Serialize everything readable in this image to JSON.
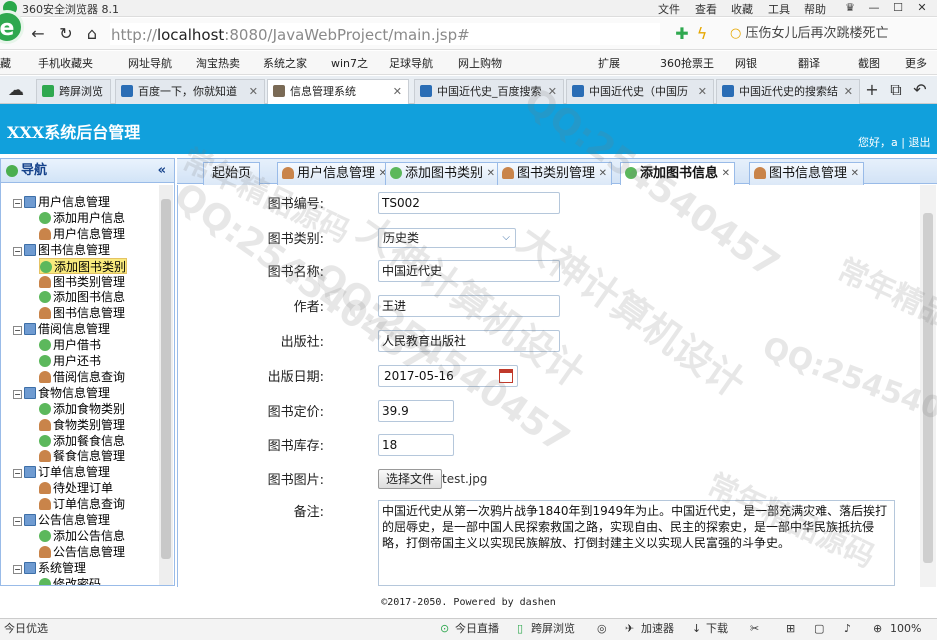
{
  "browser": {
    "window_title": "360安全浏览器 8.1",
    "menus": [
      "文件",
      "查看",
      "收藏",
      "工具",
      "帮助"
    ],
    "url_prefix": "http://",
    "url_host": "localhost",
    "url_rest": ":8080/JavaWebProject/main.jsp#",
    "search_text": "压伤女儿后再次跳楼死亡",
    "favorites": [
      "藏",
      "手机收藏夹",
      "网址导航",
      "淘宝热卖",
      "系统之家",
      "win7之",
      "足球导航",
      "网上购物",
      "扩展",
      "360抢票王",
      "网银",
      "翻译",
      "截图",
      "更多"
    ],
    "tabs": [
      {
        "label": "跨屏浏览",
        "active": false
      },
      {
        "label": "百度一下，你就知道",
        "active": false
      },
      {
        "label": "信息管理系统",
        "active": true
      },
      {
        "label": "中国近代史_百度搜索",
        "active": false
      },
      {
        "label": "中国近代史（中国历",
        "active": false
      },
      {
        "label": "中国近代史的搜索结",
        "active": false
      }
    ]
  },
  "app": {
    "title": "XXX系统后台管理",
    "user_text": "您好，a",
    "logout": "退出"
  },
  "sidebar": {
    "title": "导航",
    "collapse": "«",
    "nodes": [
      {
        "label": "用户信息管理",
        "level": 0,
        "icon": "folder-icon"
      },
      {
        "label": "添加用户信息",
        "level": 1,
        "icon": "add-icon"
      },
      {
        "label": "用户信息管理",
        "level": 1,
        "icon": "user-icon"
      },
      {
        "label": "图书信息管理",
        "level": 0,
        "icon": "folder-icon"
      },
      {
        "label": "添加图书类别",
        "level": 1,
        "icon": "add-icon",
        "selected": true
      },
      {
        "label": "图书类别管理",
        "level": 1,
        "icon": "user-icon"
      },
      {
        "label": "添加图书信息",
        "level": 1,
        "icon": "add-icon"
      },
      {
        "label": "图书信息管理",
        "level": 1,
        "icon": "user-icon"
      },
      {
        "label": "借阅信息管理",
        "level": 0,
        "icon": "folder-icon"
      },
      {
        "label": "用户借书",
        "level": 1,
        "icon": "add-icon"
      },
      {
        "label": "用户还书",
        "level": 1,
        "icon": "add-icon"
      },
      {
        "label": "借阅信息查询",
        "level": 1,
        "icon": "user-icon"
      },
      {
        "label": "食物信息管理",
        "level": 0,
        "icon": "folder-icon"
      },
      {
        "label": "添加食物类别",
        "level": 1,
        "icon": "add-icon"
      },
      {
        "label": "食物类别管理",
        "level": 1,
        "icon": "user-icon"
      },
      {
        "label": "添加餐食信息",
        "level": 1,
        "icon": "add-icon"
      },
      {
        "label": "餐食信息管理",
        "level": 1,
        "icon": "user-icon"
      },
      {
        "label": "订单信息管理",
        "level": 0,
        "icon": "folder-icon"
      },
      {
        "label": "待处理订单",
        "level": 1,
        "icon": "user-icon"
      },
      {
        "label": "订单信息查询",
        "level": 1,
        "icon": "user-icon"
      },
      {
        "label": "公告信息管理",
        "level": 0,
        "icon": "folder-icon"
      },
      {
        "label": "添加公告信息",
        "level": 1,
        "icon": "add-icon"
      },
      {
        "label": "公告信息管理",
        "level": 1,
        "icon": "user-icon"
      },
      {
        "label": "系统管理",
        "level": 0,
        "icon": "folder-icon"
      },
      {
        "label": "修改密码",
        "level": 1,
        "icon": "pencil-icon"
      }
    ]
  },
  "main_tabs": [
    {
      "label": "起始页",
      "icon": "",
      "closable": false
    },
    {
      "label": "用户信息管理",
      "icon": "user-icon",
      "closable": true
    },
    {
      "label": "添加图书类别",
      "icon": "add-icon",
      "closable": true
    },
    {
      "label": "图书类别管理",
      "icon": "user-icon",
      "closable": true
    },
    {
      "label": "添加图书信息",
      "icon": "add-icon",
      "closable": true,
      "active": true
    },
    {
      "label": "图书信息管理",
      "icon": "user-icon",
      "closable": true
    }
  ],
  "form": {
    "book_no_label": "图书编号:",
    "book_no": "TS002",
    "category_label": "图书类别:",
    "category": "历史类",
    "name_label": "图书名称:",
    "name": "中国近代史",
    "author_label": "作者:",
    "author": "王进",
    "publisher_label": "出版社:",
    "publisher": "人民教育出版社",
    "pub_date_label": "出版日期:",
    "pub_date": "2017-05-16",
    "price_label": "图书定价:",
    "price": "39.9",
    "stock_label": "图书库存:",
    "stock": "18",
    "photo_label": "图书图片:",
    "file_button": "选择文件",
    "file_name": "test.jpg",
    "remark_label": "备注:",
    "remark": "中国近代史从第一次鸦片战争1840年到1949年为止。中国近代史，是一部充满灾难、落后挨打的屈辱史，是一部中国人民探索救国之路，实现自由、民主的探索史，是一部中华民族抵抗侵略，打倒帝国主义以实现民族解放、打倒封建主义以实现人民富强的斗争史。"
  },
  "footer": "©2017-2050. Powered by dashen",
  "statusbar": {
    "left": "今日优选",
    "live": "今日直播",
    "cross": "跨屏浏览",
    "accelerate": "加速器",
    "download": "下载",
    "zoom": "100%"
  },
  "watermarks": [
    "大神计算机设计",
    "QQ:254540457",
    "常年精品源码"
  ]
}
